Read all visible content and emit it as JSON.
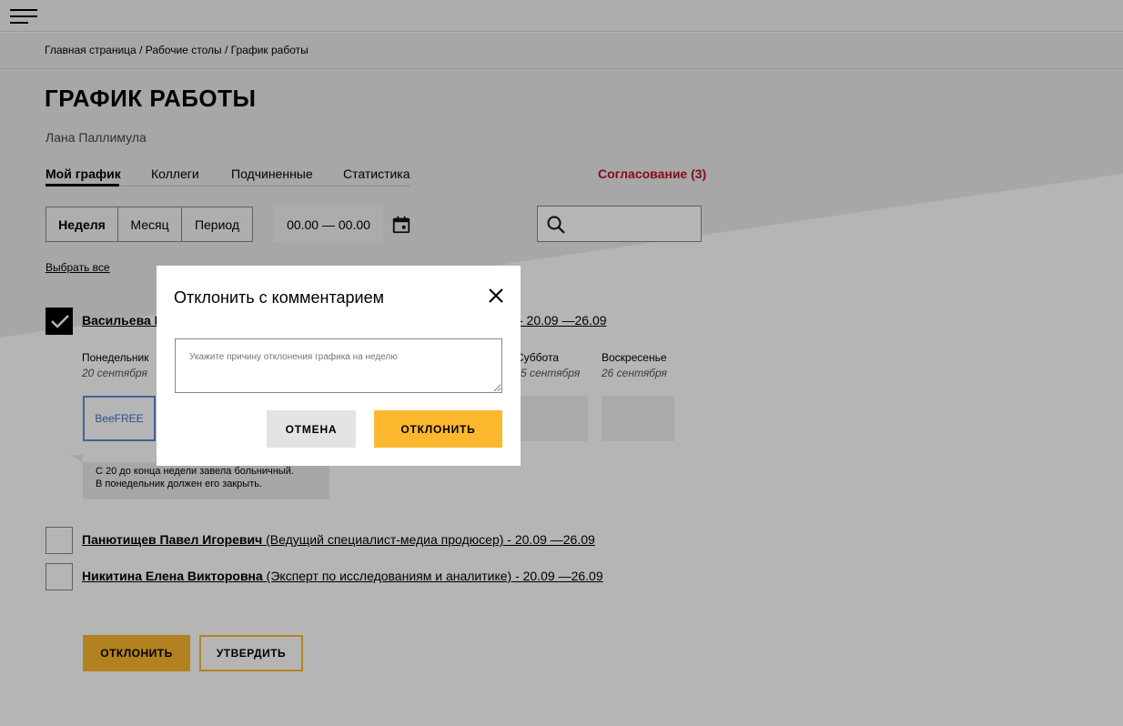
{
  "breadcrumb": "Главная страница / Рабочие столы / График работы",
  "page_title": "ГРАФИК РАБОТЫ",
  "user_name": "Лана Паллимула",
  "tabs": [
    {
      "label": "Мой график",
      "active": true
    },
    {
      "label": "Коллеги",
      "active": false
    },
    {
      "label": "Подчиненные",
      "active": false
    },
    {
      "label": "Статистика",
      "active": false
    }
  ],
  "approval_link": "Согласование (3)",
  "period_options": [
    {
      "label": "Неделя",
      "active": true
    },
    {
      "label": "Месяц",
      "active": false
    },
    {
      "label": "Период",
      "active": false
    }
  ],
  "date_range": "00.00 — 00.00",
  "select_all": "Выбрать все",
  "employees": [
    {
      "name": "Васильева Е",
      "details": " - 20.09 —26.09",
      "checked": true
    },
    {
      "name": "Панютищев Павел Игоревич",
      "details": " (Ведущий специалист-медиа продюсер) - 20.09 —26.09",
      "checked": false
    },
    {
      "name": "Никитина Елена Викторовна",
      "details": " (Эксперт по исследованиям и аналитике) - 20.09 —26.09",
      "checked": false
    }
  ],
  "days": [
    {
      "name": "Понедельник",
      "date": "20 сентября"
    },
    {
      "name": "Суббота",
      "date": "5 сентября"
    },
    {
      "name": "Воскресенье",
      "date": "26 сентября"
    }
  ],
  "shift_free_label": "BeeFREE",
  "comment": {
    "line1": "С 20 до конца недели завела больничный.",
    "line2": "В понедельник должен его закрыть."
  },
  "actions": {
    "reject": "ОТКЛОНИТЬ",
    "approve": "УТВЕРДИТЬ"
  },
  "modal": {
    "title": "Отклонить с комментарием",
    "placeholder": "Укажите причину отклонения графика на неделю",
    "cancel": "ОТМЕНА",
    "confirm": "ОТКЛОНИТЬ"
  },
  "colors": {
    "accent": "#fbb82e",
    "approval_link": "#c0102a",
    "free_shift_border": "#5a8fd6"
  },
  "icons": [
    "menu-icon",
    "calendar-icon",
    "search-icon",
    "check-icon",
    "close-icon"
  ]
}
